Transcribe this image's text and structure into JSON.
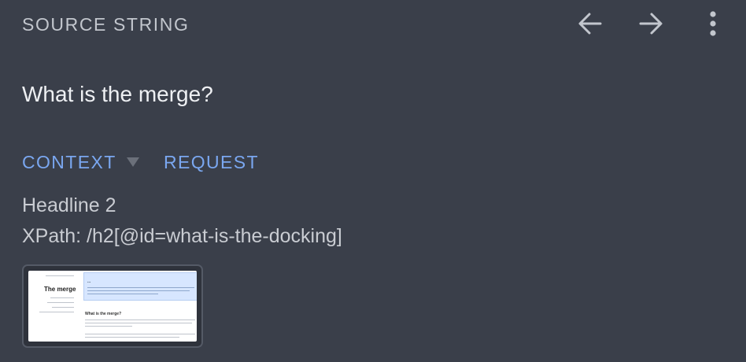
{
  "header": {
    "title": "SOURCE STRING"
  },
  "toolbar": {
    "prev_icon": "arrow-left-icon",
    "next_icon": "arrow-right-icon",
    "more_icon": "more-vertical-icon"
  },
  "source": {
    "text": "What is the merge?"
  },
  "tabs": [
    {
      "label": "CONTEXT",
      "has_dropdown": true
    },
    {
      "label": "REQUEST",
      "has_dropdown": false
    }
  ],
  "context": {
    "element_type": "Headline 2",
    "xpath": "XPath: /h2[@id=what-is-the-docking]"
  },
  "screenshot_thumbnail": {
    "page_title": "The merge",
    "hero_heading": "...",
    "section_heading": "What is the merge?"
  },
  "colors": {
    "background": "#3a3f4a",
    "accent": "#7aa7f0",
    "muted_text": "#c2c6cd"
  }
}
